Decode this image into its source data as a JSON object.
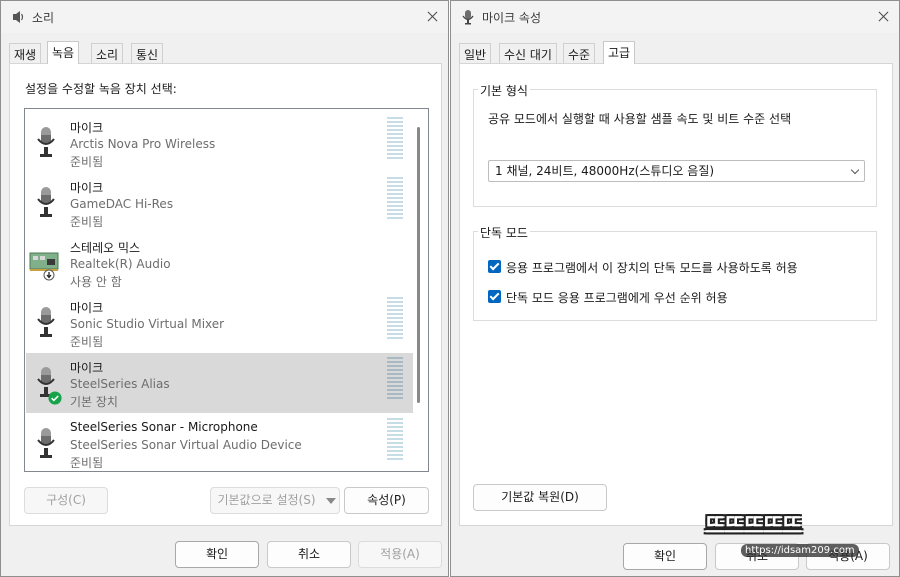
{
  "sound_dialog": {
    "title": "소리",
    "tabs": [
      "재생",
      "녹음",
      "소리",
      "통신"
    ],
    "active_tab": "녹음",
    "instruction": "설정을 수정할 녹음 장치 선택:",
    "devices": [
      {
        "name": "마이크",
        "description": "Arctis Nova Pro Wireless",
        "status": "준비됨",
        "icon": "microphone-icon",
        "selected": false
      },
      {
        "name": "마이크",
        "description": "GameDAC Hi-Res",
        "status": "준비됨",
        "icon": "microphone-icon",
        "selected": false
      },
      {
        "name": "스테레오 믹스",
        "description": "Realtek(R) Audio",
        "status": "사용 안 함",
        "icon": "sound-card-icon",
        "selected": false
      },
      {
        "name": "마이크",
        "description": "Sonic Studio Virtual Mixer",
        "status": "준비됨",
        "icon": "microphone-icon",
        "selected": false
      },
      {
        "name": "마이크",
        "description": "SteelSeries Alias",
        "status": "기본 장치",
        "icon": "microphone-icon",
        "selected": true
      },
      {
        "name": "SteelSeries Sonar - Microphone",
        "description": "SteelSeries Sonar Virtual Audio Device",
        "status": "준비됨",
        "icon": "microphone-icon",
        "selected": false
      }
    ],
    "buttons": {
      "configure": "구성(C)",
      "set_default": "기본값으로 설정(S)",
      "properties": "속성(P)",
      "ok": "확인",
      "cancel": "취소",
      "apply": "적용(A)"
    }
  },
  "mic_dialog": {
    "title": "마이크 속성",
    "tabs": [
      "일반",
      "수신 대기",
      "수준",
      "고급"
    ],
    "active_tab": "고급",
    "default_format": {
      "group_title": "기본 형식",
      "description": "공유 모드에서 실행할 때 사용할 샘플 속도 및 비트 수준 선택",
      "selected": "1 채널, 24비트, 48000Hz(스튜디오 음질)"
    },
    "exclusive_mode": {
      "group_title": "단독 모드",
      "options": [
        {
          "label": "응용 프로그램에서 이 장치의 단독 모드를 사용하도록 허용",
          "checked": true
        },
        {
          "label": "단독 모드 응용 프로그램에게 우선 순위 허용",
          "checked": true
        }
      ]
    },
    "buttons": {
      "restore_defaults": "기본값 복원(D)",
      "ok": "확인",
      "cancel": "취소",
      "apply": "적용(A)"
    }
  },
  "watermark": {
    "title": "뜨뜨뜨뜨뜨",
    "url": "https://idsam209.com"
  },
  "colors": {
    "accent": "#0067c0",
    "default_badge": "#16a34a",
    "selection": "#d9d9d9"
  }
}
